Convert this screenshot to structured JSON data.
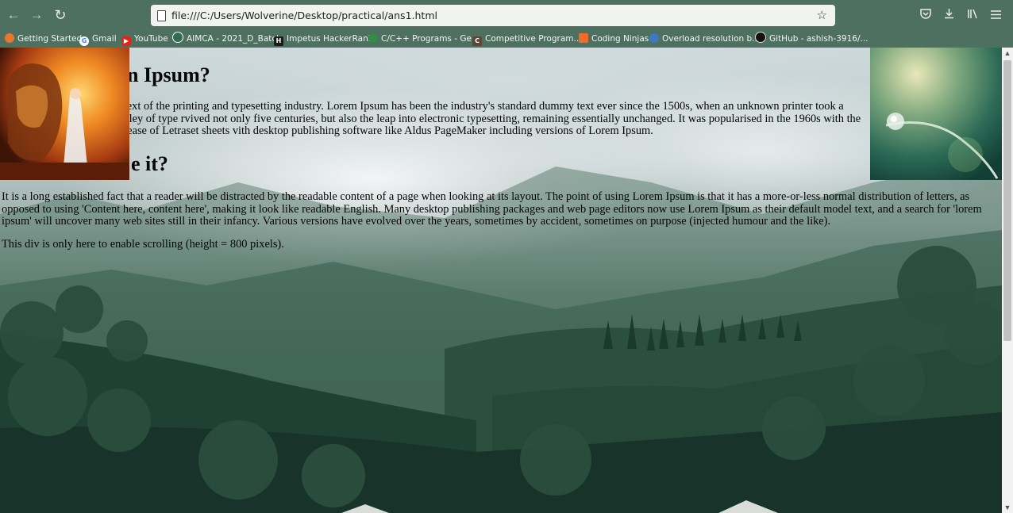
{
  "browser": {
    "url": "file:///C:/Users/Wolverine/Desktop/practical/ans1.html",
    "bookmarks": [
      {
        "label": "Getting Started",
        "icon": "firefox-icon",
        "color": "#e8772e"
      },
      {
        "label": "Gmail",
        "icon": "google-icon",
        "color": "#4285f4"
      },
      {
        "label": "YouTube",
        "icon": "youtube-icon",
        "color": "#e62117"
      },
      {
        "label": "AIMCA - 2021_D_Batch",
        "icon": "group-icon",
        "color": "#2f6f4f"
      },
      {
        "label": "Impetus HackerRank",
        "icon": "hackerrank-icon",
        "color": "#1b1b1b"
      },
      {
        "label": "C/C++ Programs - Ge...",
        "icon": "geeksforgeeks-icon",
        "color": "#2f8d46"
      },
      {
        "label": "Competitive Program...",
        "icon": "codechef-icon",
        "color": "#5b4638"
      },
      {
        "label": "Coding Ninjas",
        "icon": "codingninjas-icon",
        "color": "#f36b26"
      },
      {
        "label": "Overload resolution b...",
        "icon": "cppreference-icon",
        "color": "#3a7bbf"
      },
      {
        "label": "GitHub - ashish-3916/...",
        "icon": "github-icon",
        "color": "#111111"
      }
    ]
  },
  "page": {
    "heading1": "n Ipsum?",
    "paragraph1": "y text of the printing and typesetting industry. Lorem Ipsum has been the industry's standard dummy text ever since the 1500s, when an unknown printer took a galley of type rvived not only five centuries, but also the leap into electronic typesetting, remaining essentially unchanged. It was popularised in the 1960s with the release of Letraset sheets vith desktop publishing software like Aldus PageMaker including versions of Lorem Ipsum.",
    "heading2": "e it?",
    "paragraph2": "It is a long established fact that a reader will be distracted by the readable content of a page when looking at its layout. The point of using Lorem Ipsum is that it has a more-or-less normal distribution of letters, as opposed to using 'Content here, content here', making it look like readable English. Many desktop publishing packages and web page editors now use Lorem Ipsum as their default model text, and a search for 'lorem ipsum' will uncover many web sites still in their infancy. Various versions have evolved over the years, sometimes by accident, sometimes on purpose (injected humour and the like).",
    "paragraph3": "This div is only here to enable scrolling (height = 800 pixels)."
  },
  "images": {
    "left": "lion-and-woman-painting",
    "right": "water-droplet-on-grass",
    "background": "misty-forest-hills"
  }
}
